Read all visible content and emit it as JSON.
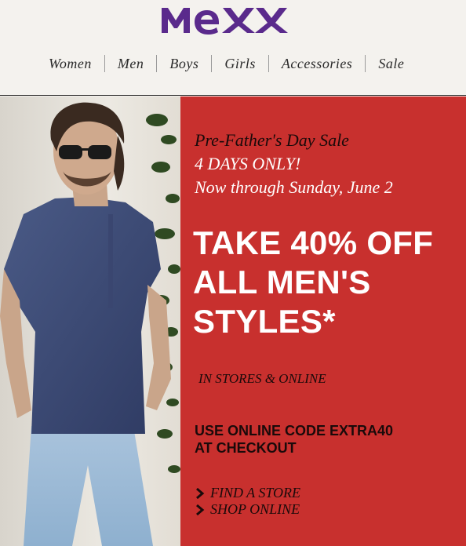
{
  "brand": {
    "logo_text": "MEXX",
    "color": "#5a2a8c"
  },
  "nav": {
    "items": [
      {
        "label": "Women"
      },
      {
        "label": "Men"
      },
      {
        "label": "Boys"
      },
      {
        "label": "Girls"
      },
      {
        "label": "Accessories"
      },
      {
        "label": "Sale"
      }
    ]
  },
  "promo": {
    "pre_line1": "Pre-Father's Day Sale",
    "pre_line2": "4 DAYS ONLY!",
    "pre_line3": "Now through Sunday, June 2",
    "headline_line1": "TAKE 40% OFF",
    "headline_line2": "ALL MEN'S",
    "headline_line3": "STYLES*",
    "channels": "IN STORES & ONLINE",
    "code_line1": "USE ONLINE CODE EXTRA40",
    "code_line2": "AT CHECKOUT",
    "links": [
      {
        "label": "FIND A STORE",
        "icon": "chevron-right-icon"
      },
      {
        "label": "SHOP ONLINE",
        "icon": "chevron-right-icon"
      }
    ],
    "panel_color": "#c8302e"
  },
  "photo": {
    "description_icon": "model-photo"
  }
}
